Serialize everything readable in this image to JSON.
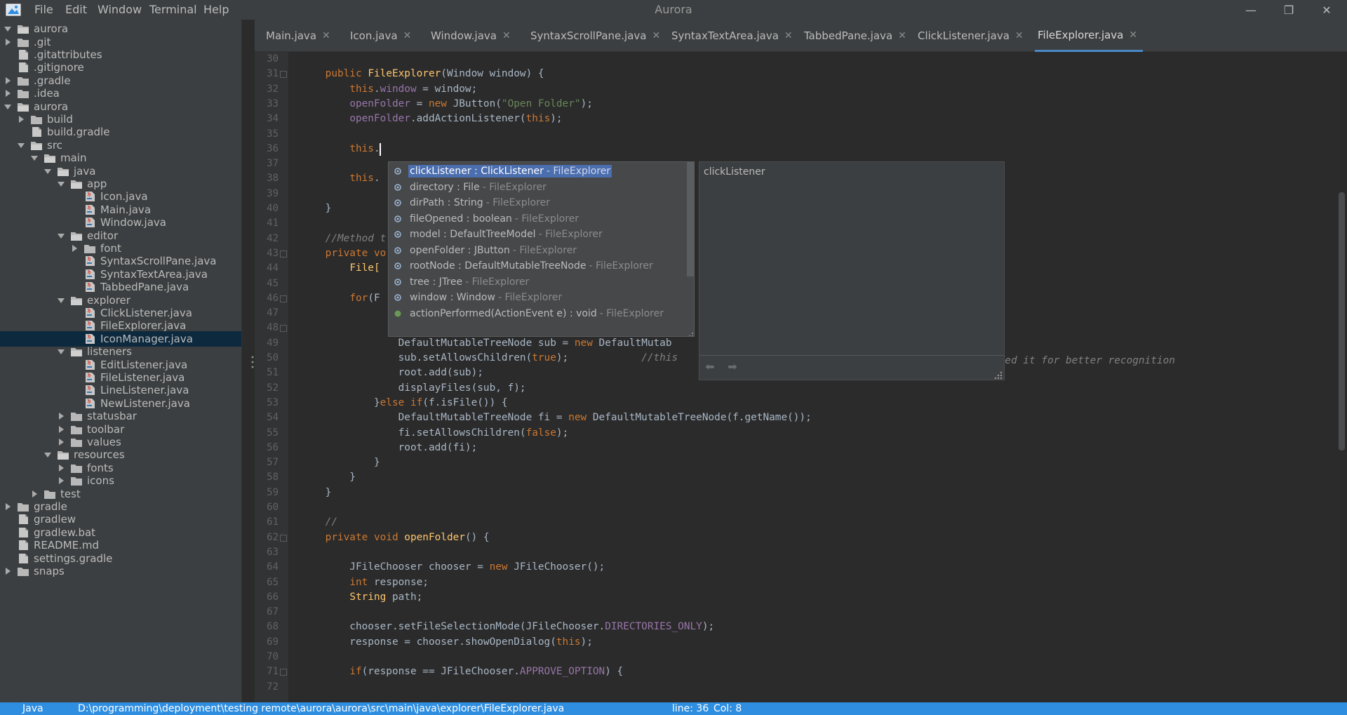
{
  "window": {
    "title": "Aurora",
    "menu": [
      "File",
      "Edit",
      "Window",
      "Terminal",
      "Help"
    ],
    "minimize": "—",
    "maximize": "❐",
    "close": "✕"
  },
  "tree": [
    {
      "label": "aurora",
      "depth": 0,
      "arrow": "down",
      "icon": "folder-open-icon"
    },
    {
      "label": ".git",
      "depth": 0,
      "arrow": "right",
      "icon": "folder-icon"
    },
    {
      "label": ".gitattributes",
      "depth": 0,
      "arrow": "none",
      "icon": "file-icon"
    },
    {
      "label": ".gitignore",
      "depth": 0,
      "arrow": "none",
      "icon": "file-icon"
    },
    {
      "label": ".gradle",
      "depth": 0,
      "arrow": "right",
      "icon": "folder-icon"
    },
    {
      "label": ".idea",
      "depth": 0,
      "arrow": "right",
      "icon": "folder-icon"
    },
    {
      "label": "aurora",
      "depth": 0,
      "arrow": "down",
      "icon": "folder-open-icon"
    },
    {
      "label": "build",
      "depth": 1,
      "arrow": "right",
      "icon": "folder-icon"
    },
    {
      "label": "build.gradle",
      "depth": 1,
      "arrow": "none",
      "icon": "file-icon"
    },
    {
      "label": "src",
      "depth": 1,
      "arrow": "down",
      "icon": "folder-open-icon"
    },
    {
      "label": "main",
      "depth": 2,
      "arrow": "down",
      "icon": "folder-open-icon"
    },
    {
      "label": "java",
      "depth": 3,
      "arrow": "down",
      "icon": "folder-open-icon"
    },
    {
      "label": "app",
      "depth": 4,
      "arrow": "down",
      "icon": "folder-open-icon"
    },
    {
      "label": "Icon.java",
      "depth": 5,
      "arrow": "none",
      "icon": "java-file-icon"
    },
    {
      "label": "Main.java",
      "depth": 5,
      "arrow": "none",
      "icon": "java-file-icon"
    },
    {
      "label": "Window.java",
      "depth": 5,
      "arrow": "none",
      "icon": "java-file-icon"
    },
    {
      "label": "editor",
      "depth": 4,
      "arrow": "down",
      "icon": "folder-open-icon"
    },
    {
      "label": "font",
      "depth": 5,
      "arrow": "right",
      "icon": "folder-icon"
    },
    {
      "label": "SyntaxScrollPane.java",
      "depth": 5,
      "arrow": "none",
      "icon": "java-file-icon"
    },
    {
      "label": "SyntaxTextArea.java",
      "depth": 5,
      "arrow": "none",
      "icon": "java-file-icon"
    },
    {
      "label": "TabbedPane.java",
      "depth": 5,
      "arrow": "none",
      "icon": "java-file-icon"
    },
    {
      "label": "explorer",
      "depth": 4,
      "arrow": "down",
      "icon": "folder-open-icon"
    },
    {
      "label": "ClickListener.java",
      "depth": 5,
      "arrow": "none",
      "icon": "java-file-icon"
    },
    {
      "label": "FileExplorer.java",
      "depth": 5,
      "arrow": "none",
      "icon": "java-file-icon"
    },
    {
      "label": "IconManager.java",
      "depth": 5,
      "arrow": "none",
      "icon": "java-file-icon",
      "selected": true
    },
    {
      "label": "listeners",
      "depth": 4,
      "arrow": "down",
      "icon": "folder-open-icon"
    },
    {
      "label": "EditListener.java",
      "depth": 5,
      "arrow": "none",
      "icon": "java-file-icon"
    },
    {
      "label": "FileListener.java",
      "depth": 5,
      "arrow": "none",
      "icon": "java-file-icon"
    },
    {
      "label": "LineListener.java",
      "depth": 5,
      "arrow": "none",
      "icon": "java-file-icon"
    },
    {
      "label": "NewListener.java",
      "depth": 5,
      "arrow": "none",
      "icon": "java-file-icon"
    },
    {
      "label": "statusbar",
      "depth": 4,
      "arrow": "right",
      "icon": "folder-icon"
    },
    {
      "label": "toolbar",
      "depth": 4,
      "arrow": "right",
      "icon": "folder-icon"
    },
    {
      "label": "values",
      "depth": 4,
      "arrow": "right",
      "icon": "folder-icon"
    },
    {
      "label": "resources",
      "depth": 3,
      "arrow": "down",
      "icon": "folder-open-icon"
    },
    {
      "label": "fonts",
      "depth": 4,
      "arrow": "right",
      "icon": "folder-icon"
    },
    {
      "label": "icons",
      "depth": 4,
      "arrow": "right",
      "icon": "folder-icon"
    },
    {
      "label": "test",
      "depth": 2,
      "arrow": "right",
      "icon": "folder-icon"
    },
    {
      "label": "gradle",
      "depth": 0,
      "arrow": "right",
      "icon": "folder-icon"
    },
    {
      "label": "gradlew",
      "depth": 0,
      "arrow": "none",
      "icon": "file-icon"
    },
    {
      "label": "gradlew.bat",
      "depth": 0,
      "arrow": "none",
      "icon": "file-icon"
    },
    {
      "label": "README.md",
      "depth": 0,
      "arrow": "none",
      "icon": "file-icon"
    },
    {
      "label": "settings.gradle",
      "depth": 0,
      "arrow": "none",
      "icon": "file-icon"
    },
    {
      "label": "snaps",
      "depth": 0,
      "arrow": "right",
      "icon": "folder-icon"
    }
  ],
  "tabs": [
    {
      "label": "Main.java",
      "close": "✕"
    },
    {
      "label": "Icon.java",
      "close": "✕"
    },
    {
      "label": "Window.java",
      "close": "✕"
    },
    {
      "label": "SyntaxScrollPane.java",
      "close": "✕"
    },
    {
      "label": "SyntaxTextArea.java",
      "close": "✕"
    },
    {
      "label": "TabbedPane.java",
      "close": "✕"
    },
    {
      "label": "ClickListener.java",
      "close": "✕"
    },
    {
      "label": "FileExplorer.java",
      "close": "✕",
      "active": true
    }
  ],
  "code_lines": [
    {
      "n": "30",
      "fold": false,
      "segs": []
    },
    {
      "n": "31",
      "fold": true,
      "segs": [
        [
          "    ",
          ""
        ],
        [
          "public ",
          "kw"
        ],
        [
          "FileExplorer",
          "fn"
        ],
        [
          "(Window window) {",
          ""
        ]
      ]
    },
    {
      "n": "32",
      "fold": false,
      "segs": [
        [
          "        ",
          ""
        ],
        [
          "this",
          "kw"
        ],
        [
          ".",
          ""
        ],
        [
          "window",
          "field-purple"
        ],
        [
          " = window;",
          ""
        ]
      ]
    },
    {
      "n": "33",
      "fold": false,
      "segs": [
        [
          "        ",
          ""
        ],
        [
          "openFolder",
          "field-purple"
        ],
        [
          " = ",
          ""
        ],
        [
          "new ",
          "kw"
        ],
        [
          "JButton(",
          ""
        ],
        [
          "\"Open Folder\"",
          "str"
        ],
        [
          ");",
          ""
        ]
      ]
    },
    {
      "n": "34",
      "fold": false,
      "segs": [
        [
          "        ",
          ""
        ],
        [
          "openFolder",
          "field-purple"
        ],
        [
          ".addActionListener(",
          ""
        ],
        [
          "this",
          "kw"
        ],
        [
          ");",
          ""
        ]
      ]
    },
    {
      "n": "35",
      "fold": false,
      "segs": []
    },
    {
      "n": "36",
      "fold": false,
      "segs": [
        [
          "        ",
          ""
        ],
        [
          "this",
          "kw"
        ],
        [
          ".",
          ""
        ]
      ]
    },
    {
      "n": "37",
      "fold": false,
      "segs": []
    },
    {
      "n": "38",
      "fold": false,
      "segs": [
        [
          "        ",
          ""
        ],
        [
          "this",
          "kw"
        ],
        [
          ".",
          ""
        ]
      ]
    },
    {
      "n": "39",
      "fold": false,
      "segs": []
    },
    {
      "n": "40",
      "fold": false,
      "segs": [
        [
          "    }",
          ""
        ]
      ]
    },
    {
      "n": "41",
      "fold": false,
      "segs": []
    },
    {
      "n": "42",
      "fold": false,
      "segs": [
        [
          "    ",
          ""
        ],
        [
          "//Method t",
          "cmt"
        ]
      ]
    },
    {
      "n": "43",
      "fold": true,
      "segs": [
        [
          "    ",
          ""
        ],
        [
          "private vo",
          "kw"
        ]
      ]
    },
    {
      "n": "44",
      "fold": false,
      "segs": [
        [
          "        ",
          ""
        ],
        [
          "File[",
          "fn"
        ]
      ]
    },
    {
      "n": "45",
      "fold": false,
      "segs": []
    },
    {
      "n": "46",
      "fold": true,
      "segs": [
        [
          "        ",
          ""
        ],
        [
          "for",
          "kw"
        ],
        [
          "(F",
          ""
        ]
      ]
    },
    {
      "n": "47",
      "fold": false,
      "segs": []
    },
    {
      "n": "48",
      "fold": true,
      "segs": []
    },
    {
      "n": "49",
      "fold": false,
      "segs": [
        [
          "                DefaultMutableTreeNode sub = ",
          ""
        ],
        [
          "new ",
          "kw"
        ],
        [
          "DefaultMutab",
          ""
        ]
      ]
    },
    {
      "n": "50",
      "fold": false,
      "segs": [
        [
          "                sub.setAllowsChildren(",
          ""
        ],
        [
          "true",
          "kw"
        ],
        [
          ");            ",
          ""
        ],
        [
          "//this",
          "cmt"
        ]
      ]
    },
    {
      "n": "51",
      "fold": false,
      "segs": [
        [
          "                root.add(sub);",
          ""
        ]
      ]
    },
    {
      "n": "52",
      "fold": false,
      "segs": [
        [
          "                displayFiles(sub, f);",
          ""
        ]
      ]
    },
    {
      "n": "53",
      "fold": false,
      "segs": [
        [
          "            }",
          ""
        ],
        [
          "else if",
          "kw"
        ],
        [
          "(f.isFile()) {",
          ""
        ]
      ]
    },
    {
      "n": "54",
      "fold": false,
      "segs": [
        [
          "                DefaultMutableTreeNode fi = ",
          ""
        ],
        [
          "new ",
          "kw"
        ],
        [
          "DefaultMutableTreeNode(f.getName());",
          ""
        ]
      ]
    },
    {
      "n": "55",
      "fold": false,
      "segs": [
        [
          "                fi.setAllowsChildren(",
          ""
        ],
        [
          "false",
          "kw"
        ],
        [
          ");",
          ""
        ]
      ]
    },
    {
      "n": "56",
      "fold": false,
      "segs": [
        [
          "                root.add(fi);",
          ""
        ]
      ]
    },
    {
      "n": "57",
      "fold": false,
      "segs": [
        [
          "            }",
          ""
        ]
      ]
    },
    {
      "n": "58",
      "fold": false,
      "segs": [
        [
          "        }",
          ""
        ]
      ]
    },
    {
      "n": "59",
      "fold": false,
      "segs": [
        [
          "    }",
          ""
        ]
      ]
    },
    {
      "n": "60",
      "fold": false,
      "segs": []
    },
    {
      "n": "61",
      "fold": false,
      "segs": [
        [
          "    ",
          ""
        ],
        [
          "//",
          "cmt"
        ]
      ]
    },
    {
      "n": "62",
      "fold": true,
      "segs": [
        [
          "    ",
          ""
        ],
        [
          "private void ",
          "kw"
        ],
        [
          "openFolder",
          "fn"
        ],
        [
          "() {",
          ""
        ]
      ]
    },
    {
      "n": "63",
      "fold": false,
      "segs": []
    },
    {
      "n": "64",
      "fold": false,
      "segs": [
        [
          "        JFileChooser chooser = ",
          ""
        ],
        [
          "new ",
          "kw"
        ],
        [
          "JFileChooser();",
          ""
        ]
      ]
    },
    {
      "n": "65",
      "fold": false,
      "segs": [
        [
          "        ",
          ""
        ],
        [
          "int ",
          "kw"
        ],
        [
          "response;",
          ""
        ]
      ]
    },
    {
      "n": "66",
      "fold": false,
      "segs": [
        [
          "        ",
          ""
        ],
        [
          "String",
          "fn"
        ],
        [
          " path;",
          ""
        ]
      ]
    },
    {
      "n": "67",
      "fold": false,
      "segs": []
    },
    {
      "n": "68",
      "fold": false,
      "segs": [
        [
          "        chooser.setFileSelectionMode(JFileChooser.",
          ""
        ],
        [
          "DIRECTORIES_ONLY",
          "field-purple"
        ],
        [
          ");",
          ""
        ]
      ]
    },
    {
      "n": "69",
      "fold": false,
      "segs": [
        [
          "        response = chooser.showOpenDialog(",
          ""
        ],
        [
          "this",
          "kw"
        ],
        [
          ");",
          ""
        ]
      ]
    },
    {
      "n": "70",
      "fold": false,
      "segs": []
    },
    {
      "n": "71",
      "fold": true,
      "segs": [
        [
          "        ",
          ""
        ],
        [
          "if",
          "kw"
        ],
        [
          "(response == JFileChooser.",
          ""
        ],
        [
          "APPROVE_OPTION",
          "field-purple"
        ],
        [
          ") {",
          ""
        ]
      ]
    },
    {
      "n": "72",
      "fold": false,
      "segs": []
    }
  ],
  "overflow_comment": "ut i added it for better recognition",
  "completion": {
    "items": [
      {
        "main": "clickListener : ClickListener",
        "src": "- FileExplorer",
        "kind": "field",
        "selected": true
      },
      {
        "main": "directory : File",
        "src": "- FileExplorer",
        "kind": "field"
      },
      {
        "main": "dirPath : String",
        "src": "- FileExplorer",
        "kind": "field"
      },
      {
        "main": "fileOpened : boolean",
        "src": "- FileExplorer",
        "kind": "field"
      },
      {
        "main": "model : DefaultTreeModel",
        "src": "- FileExplorer",
        "kind": "field"
      },
      {
        "main": "openFolder : JButton",
        "src": "- FileExplorer",
        "kind": "field"
      },
      {
        "main": "rootNode : DefaultMutableTreeNode",
        "src": "- FileExplorer",
        "kind": "field"
      },
      {
        "main": "tree : JTree",
        "src": "- FileExplorer",
        "kind": "field"
      },
      {
        "main": "window : Window",
        "src": "- FileExplorer",
        "kind": "field"
      },
      {
        "main": "actionPerformed(ActionEvent e) : void",
        "src": "- FileExplorer",
        "kind": "method"
      }
    ],
    "doc_title": "clickListener",
    "back": "⬅",
    "forward": "➡"
  },
  "status": {
    "language": "Java",
    "path": "D:\\programming\\deployment\\testing remote\\aurora\\aurora\\src\\main\\java\\explorer\\FileExplorer.java",
    "line": "line: 36",
    "col": "Col: 8"
  },
  "colors": {
    "accent": "#2f8ee0",
    "selection": "#4b6eaf",
    "keyword": "#cc7832",
    "string": "#6a8759",
    "comment": "#808080"
  }
}
